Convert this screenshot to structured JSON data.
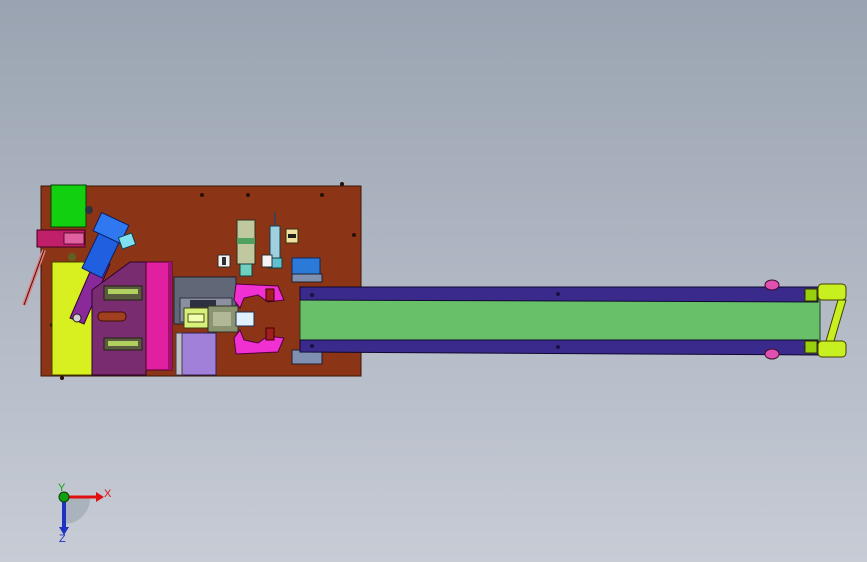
{
  "view": {
    "triad": {
      "x_label": "X",
      "y_label": "Y",
      "z_label": "Z"
    }
  },
  "colors": {
    "background_top": "#9aa3b1",
    "background_bottom": "#c7ccd5",
    "base_plate": "#8b3516",
    "belt": "#68c068",
    "rail": "#3a2a8c",
    "magenta": "#e020a0",
    "yellow_green": "#d8f020",
    "green_block": "#10d010",
    "blue_part": "#2060e0",
    "purple_block": "#a080d8",
    "axis_x": "#e01010",
    "axis_y": "#10a010",
    "axis_z": "#2030c0"
  }
}
